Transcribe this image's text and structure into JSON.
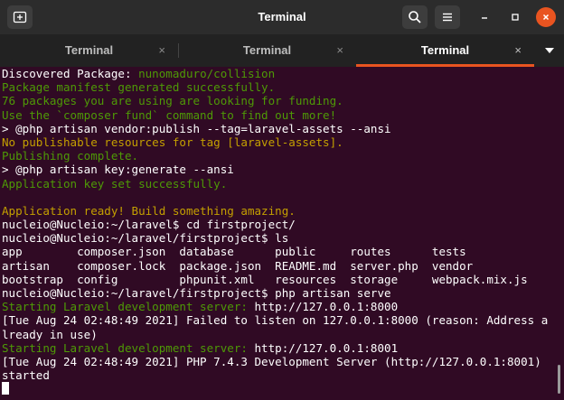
{
  "window": {
    "title": "Terminal"
  },
  "tabs": [
    {
      "label": "Terminal",
      "active": false
    },
    {
      "label": "Terminal",
      "active": false
    },
    {
      "label": "Terminal",
      "active": true
    }
  ],
  "tab_close_glyph": "×",
  "icons": {
    "new_tab": "new-tab-icon",
    "search": "search-icon",
    "menu": "hamburger-menu-icon",
    "minimize": "minimize-icon",
    "maximize": "maximize-icon",
    "close": "close-icon",
    "tab_dropdown": "chevron-down-icon"
  },
  "colors": {
    "terminal_bg": "#300a24",
    "green": "#4e9a06",
    "yellow": "#c4a000",
    "white": "#ffffff",
    "accent": "#e95420"
  },
  "terminal": {
    "lines": [
      [
        {
          "t": "Discovered Package: ",
          "c": "white"
        },
        {
          "t": "nunomaduro/collision",
          "c": "green"
        }
      ],
      [
        {
          "t": "Package manifest generated successfully.",
          "c": "green"
        }
      ],
      [
        {
          "t": "76 packages you are using are looking for funding.",
          "c": "green"
        }
      ],
      [
        {
          "t": "Use the `composer fund` command to find out more!",
          "c": "green"
        }
      ],
      [
        {
          "t": "> @php artisan vendor:publish --tag=laravel-assets --ansi",
          "c": "white"
        }
      ],
      [
        {
          "t": "No publishable resources for tag [laravel-assets].",
          "c": "yellow"
        }
      ],
      [
        {
          "t": "Publishing complete.",
          "c": "green"
        }
      ],
      [
        {
          "t": "> @php artisan key:generate --ansi",
          "c": "white"
        }
      ],
      [
        {
          "t": "Application key set successfully.",
          "c": "green"
        }
      ],
      [
        {
          "t": "",
          "c": "white"
        }
      ],
      [
        {
          "t": "Application ready! Build something amazing.",
          "c": "yellow"
        }
      ],
      [
        {
          "t": "nucleio@Nucleio:~/laravel$ cd firstproject/",
          "c": "white"
        }
      ],
      [
        {
          "t": "nucleio@Nucleio:~/laravel/firstproject$ ls",
          "c": "white"
        }
      ],
      [
        {
          "t": "app        composer.json  database      public     routes      tests",
          "c": "white"
        }
      ],
      [
        {
          "t": "artisan    composer.lock  package.json  README.md  server.php  vendor",
          "c": "white"
        }
      ],
      [
        {
          "t": "bootstrap  config         phpunit.xml   resources  storage     webpack.mix.js",
          "c": "white"
        }
      ],
      [
        {
          "t": "nucleio@Nucleio:~/laravel/firstproject$ php artisan serve",
          "c": "white"
        }
      ],
      [
        {
          "t": "Starting Laravel development server: ",
          "c": "green"
        },
        {
          "t": "http://127.0.0.1:8000",
          "c": "white"
        }
      ],
      [
        {
          "t": "[Tue Aug 24 02:48:49 2021] Failed to listen on 127.0.0.1:8000 (reason: Address a",
          "c": "white"
        }
      ],
      [
        {
          "t": "lready in use)",
          "c": "white"
        }
      ],
      [
        {
          "t": "Starting Laravel development server: ",
          "c": "green"
        },
        {
          "t": "http://127.0.0.1:8001",
          "c": "white"
        }
      ],
      [
        {
          "t": "[Tue Aug 24 02:48:49 2021] PHP 7.4.3 Development Server (http://127.0.0.1:8001)",
          "c": "white"
        }
      ],
      [
        {
          "t": "started",
          "c": "white"
        }
      ]
    ]
  }
}
